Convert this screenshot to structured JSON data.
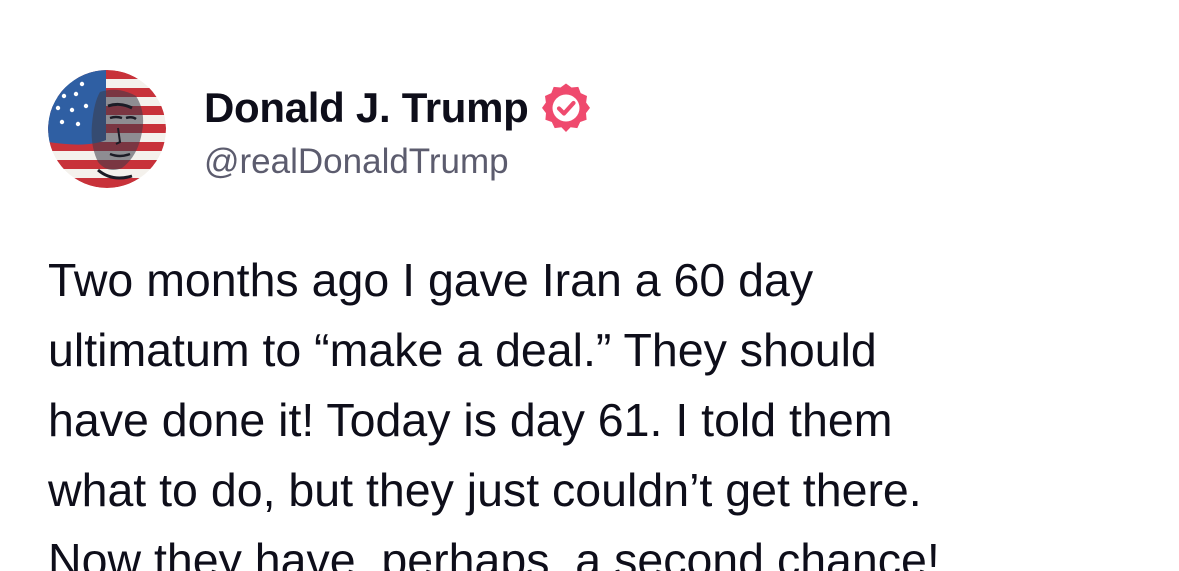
{
  "post": {
    "author": {
      "display_name": "Donald J. Trump",
      "handle": "@realDonaldTrump",
      "verified": true,
      "verified_badge_color": "#ef4a6e",
      "avatar_icon": "avatar-image"
    },
    "body_lines": [
      "Two months ago I gave Iran a 60 day",
      "ultimatum to “make a deal.” They should",
      "have done it! Today is day 61. I told them",
      "what to do, but they just couldn’t get there.",
      "Now they have, perhaps, a second chance!"
    ]
  },
  "colors": {
    "background": "#ffffff",
    "text": "#0e0e1a",
    "handle": "#5c5c6e",
    "badge": "#ef4a6e"
  }
}
